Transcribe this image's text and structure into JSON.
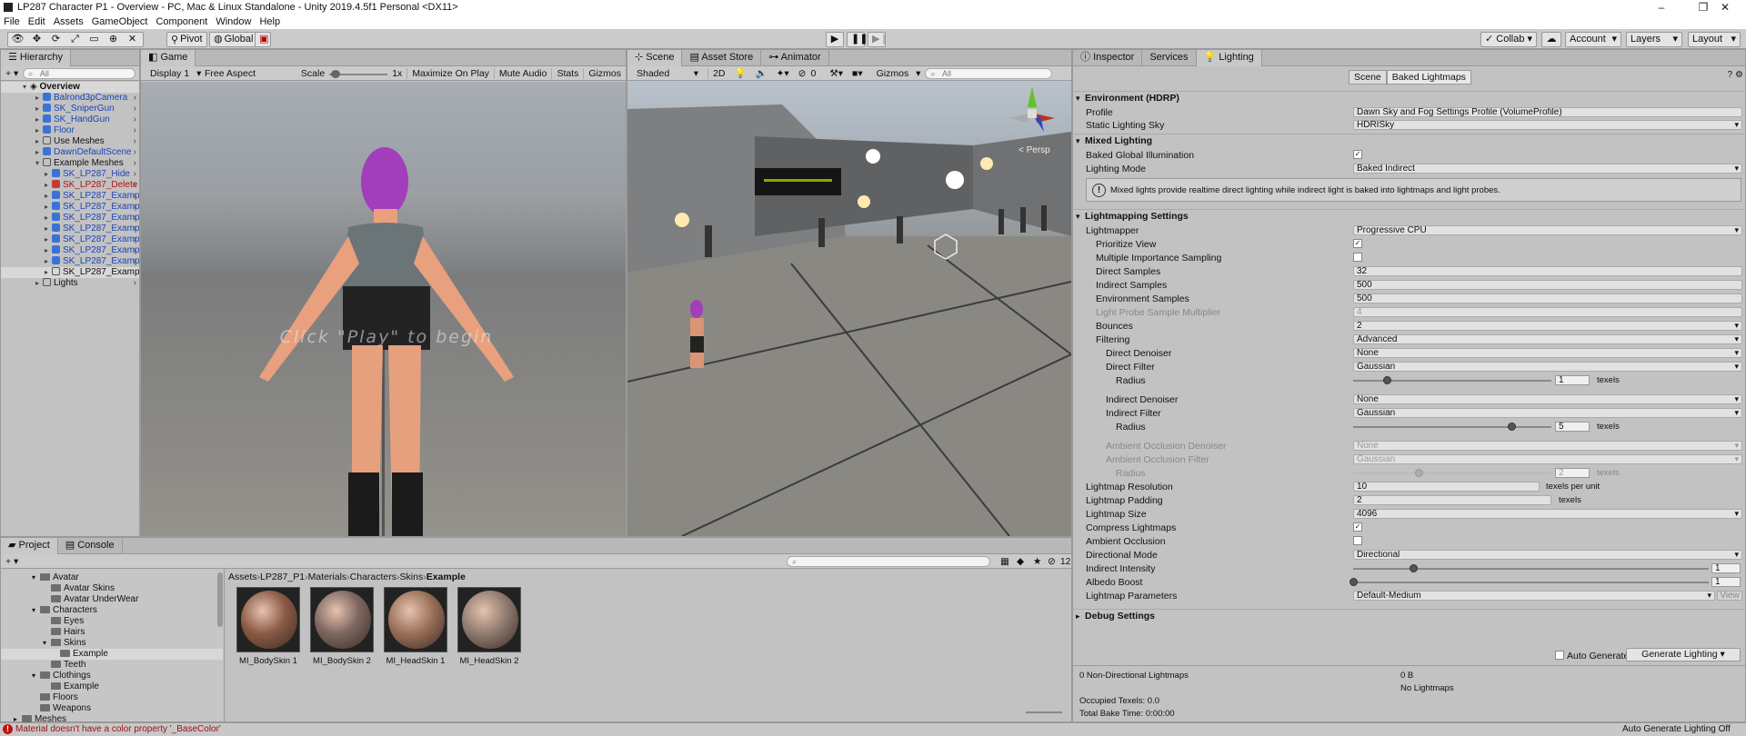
{
  "window": {
    "title": "LP287 Character P1 - Overview - PC, Mac & Linux Standalone - Unity 2019.4.5f1 Personal <DX11>",
    "minimize": "‒",
    "maximize": "❐",
    "close": "✕"
  },
  "menu": [
    "File",
    "Edit",
    "Assets",
    "GameObject",
    "Component",
    "Window",
    "Help"
  ],
  "toolbar": {
    "pivot": "Pivot",
    "global": "Global",
    "collab": "Collab ▾",
    "account": "Account",
    "layers": "Layers",
    "layout": "Layout"
  },
  "hierarchy": {
    "tab": "Hierarchy",
    "search_placeholder": "All",
    "scene": "Overview",
    "items": [
      {
        "label": "Balrond3pCamera",
        "color": "blue",
        "indent": 1
      },
      {
        "label": "SK_SniperGun",
        "color": "blue",
        "indent": 1
      },
      {
        "label": "SK_HandGun",
        "color": "blue",
        "indent": 1
      },
      {
        "label": "Floor",
        "color": "blue",
        "indent": 1
      },
      {
        "label": "Use Meshes",
        "color": "black",
        "indent": 1
      },
      {
        "label": "DawnDefaultScene",
        "color": "blue",
        "indent": 1
      },
      {
        "label": "Example Meshes",
        "color": "black",
        "indent": 1
      },
      {
        "label": "SK_LP287_Hide",
        "color": "blue",
        "indent": 2
      },
      {
        "label": "SK_LP287_Delete",
        "color": "red",
        "indent": 2
      },
      {
        "label": "SK_LP287_Examp",
        "color": "blue",
        "indent": 2
      },
      {
        "label": "SK_LP287_Examp",
        "color": "blue",
        "indent": 2
      },
      {
        "label": "SK_LP287_Examp",
        "color": "blue",
        "indent": 2
      },
      {
        "label": "SK_LP287_Examp",
        "color": "blue",
        "indent": 2
      },
      {
        "label": "SK_LP287_Examp",
        "color": "blue",
        "indent": 2
      },
      {
        "label": "SK_LP287_Examp",
        "color": "blue",
        "indent": 2
      },
      {
        "label": "SK_LP287_Examp",
        "color": "blue",
        "indent": 2
      },
      {
        "label": "SK_LP287_Examp",
        "color": "black",
        "indent": 2
      },
      {
        "label": "Lights",
        "color": "black",
        "indent": 1
      }
    ]
  },
  "game": {
    "tab": "Game",
    "display": "Display 1",
    "aspect": "Free Aspect",
    "scale_label": "Scale",
    "scale_value": "1x",
    "max_on_play": "Maximize On Play",
    "mute": "Mute Audio",
    "stats": "Stats",
    "gizmos": "Gizmos",
    "overlay_text": "Click \"Play\" to begin"
  },
  "scene": {
    "tabs": [
      "Scene",
      "Asset Store",
      "Animator"
    ],
    "shading": "Shaded",
    "mode2d": "2D",
    "hidden_count": "0",
    "gizmos": "Gizmos",
    "search_placeholder": "All",
    "persp": "< Persp"
  },
  "inspector": {
    "tabs": [
      "Inspector",
      "Services",
      "Lighting"
    ],
    "subtabs": [
      "Scene",
      "Baked Lightmaps"
    ],
    "env_header": "Environment (HDRP)",
    "profile_label": "Profile",
    "profile_value": "Dawn Sky and Fog Settings Profile (VolumeProfile)",
    "static_sky_label": "Static Lighting Sky",
    "static_sky_value": "HDRISky",
    "mixed_header": "Mixed Lighting",
    "bgi_label": "Baked Global Illumination",
    "lighting_mode_label": "Lighting Mode",
    "lighting_mode_value": "Baked Indirect",
    "info_text": "Mixed lights provide realtime direct lighting while indirect light is baked into lightmaps and light probes.",
    "lm_header": "Lightmapping Settings",
    "lightmapper_label": "Lightmapper",
    "lightmapper_value": "Progressive CPU",
    "prioritize_label": "Prioritize View",
    "mis_label": "Multiple Importance Sampling",
    "direct_samples_label": "Direct Samples",
    "direct_samples_value": "32",
    "indirect_samples_label": "Indirect Samples",
    "indirect_samples_value": "500",
    "env_samples_label": "Environment Samples",
    "env_samples_value": "500",
    "probe_mult_label": "Light Probe Sample Multiplier",
    "probe_mult_value": "4",
    "bounces_label": "Bounces",
    "bounces_value": "2",
    "filtering_label": "Filtering",
    "filtering_value": "Advanced",
    "direct_denoiser_label": "Direct Denoiser",
    "direct_denoiser_value": "None",
    "direct_filter_label": "Direct Filter",
    "direct_filter_value": "Gaussian",
    "radius_label": "Radius",
    "direct_radius_value": "1",
    "texels": "texels",
    "indirect_denoiser_label": "Indirect Denoiser",
    "indirect_denoiser_value": "None",
    "indirect_filter_label": "Indirect Filter",
    "indirect_filter_value": "Gaussian",
    "indirect_radius_value": "5",
    "ao_denoiser_label": "Ambient Occlusion Denoiser",
    "ao_denoiser_value": "None",
    "ao_filter_label": "Ambient Occlusion Filter",
    "ao_filter_value": "Gaussian",
    "ao_radius_value": "2",
    "lm_res_label": "Lightmap Resolution",
    "lm_res_value": "10",
    "texels_per_unit": "texels per unit",
    "lm_pad_label": "Lightmap Padding",
    "lm_pad_value": "2",
    "lm_size_label": "Lightmap Size",
    "lm_size_value": "4096",
    "compress_label": "Compress Lightmaps",
    "ao_label": "Ambient Occlusion",
    "dir_mode_label": "Directional Mode",
    "dir_mode_value": "Directional",
    "indirect_int_label": "Indirect Intensity",
    "indirect_int_value": "1",
    "albedo_label": "Albedo Boost",
    "albedo_value": "1",
    "lm_params_label": "Lightmap Parameters",
    "lm_params_value": "Default-Medium",
    "view": "View",
    "debug_header": "Debug Settings",
    "auto_generate": "Auto Generate",
    "generate_button": "Generate Lighting",
    "nondir": "0 Non-Directional Lightmaps",
    "size": "0 B",
    "no_lightmaps": "No Lightmaps",
    "occupied": "Occupied Texels: 0.0",
    "bake_time": "Total Bake Time: 0:00:00"
  },
  "project": {
    "tabs": [
      "Project",
      "Console"
    ],
    "folders": [
      {
        "label": "Avatar",
        "indent": 2
      },
      {
        "label": "Avatar Skins",
        "indent": 3
      },
      {
        "label": "Avatar UnderWear",
        "indent": 3
      },
      {
        "label": "Characters",
        "indent": 2
      },
      {
        "label": "Eyes",
        "indent": 3
      },
      {
        "label": "Hairs",
        "indent": 3
      },
      {
        "label": "Skins",
        "indent": 3
      },
      {
        "label": "Example",
        "indent": 4
      },
      {
        "label": "Teeth",
        "indent": 3
      },
      {
        "label": "Clothings",
        "indent": 2
      },
      {
        "label": "Example",
        "indent": 3
      },
      {
        "label": "Floors",
        "indent": 2
      },
      {
        "label": "Weapons",
        "indent": 2
      },
      {
        "label": "Meshes",
        "indent": 1
      }
    ],
    "breadcrumb": [
      "Assets",
      "LP287_P1",
      "Materials",
      "Characters",
      "Skins",
      "Example"
    ],
    "assets": [
      {
        "label": "MI_BodySkin 1",
        "tint": "#8a5a44"
      },
      {
        "label": "MI_BodySkin 2",
        "tint": "#7d6660"
      },
      {
        "label": "MI_HeadSkin 1",
        "tint": "#9a7058"
      },
      {
        "label": "MI_HeadSkin 2",
        "tint": "#8f7b70"
      }
    ],
    "count": "12"
  },
  "status": {
    "error": "Material doesn't have a color property '_BaseColor'",
    "auto_gen": "Auto Generate Lighting Off"
  }
}
